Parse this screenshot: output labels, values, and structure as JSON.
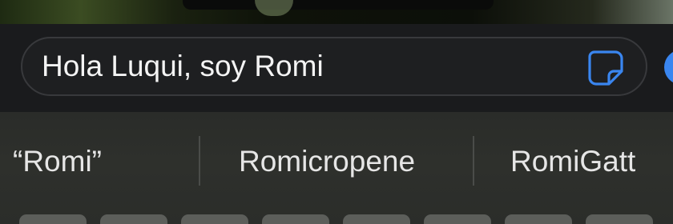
{
  "message_field": {
    "value": "Hola Luqui, soy Romi"
  },
  "buttons": {
    "sticker_icon": "sticker-icon",
    "send_icon": "send-icon"
  },
  "suggestions": [
    {
      "label": "“Romi”"
    },
    {
      "label": "Romicropene"
    },
    {
      "label": "RomiGatt"
    }
  ],
  "colors": {
    "accent": "#3a86f0",
    "field_background": "#1e1f21",
    "keyboard_background": "#2e302c",
    "text": "#f4f4f4"
  }
}
